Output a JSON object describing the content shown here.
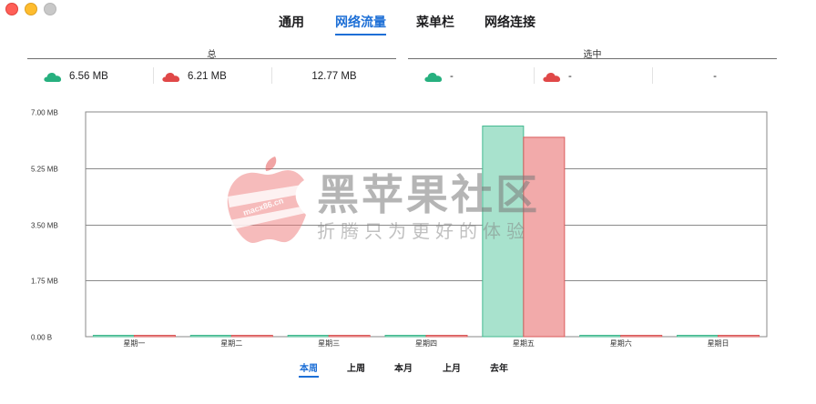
{
  "window": {
    "controls": [
      "close",
      "minimize",
      "maximize"
    ]
  },
  "tabs": [
    {
      "label": "通用",
      "active": false
    },
    {
      "label": "网络流量",
      "active": true
    },
    {
      "label": "菜单栏",
      "active": false
    },
    {
      "label": "网络连接",
      "active": false
    }
  ],
  "summary": {
    "total": {
      "title": "总",
      "upload": "6.56 MB",
      "download": "6.21 MB",
      "sum": "12.77 MB"
    },
    "selected": {
      "title": "选中",
      "upload": "-",
      "download": "-",
      "sum": "-"
    }
  },
  "colors": {
    "upload": "#27b07f",
    "download": "#e04848",
    "upload_bar": "#a8e2cd",
    "download_bar": "#f2aaaa",
    "accent": "#1d6fd6"
  },
  "icons": {
    "upload": "cloud-upload-icon",
    "download": "cloud-download-icon"
  },
  "chart_data": {
    "type": "bar",
    "categories": [
      "星期一",
      "星期二",
      "星期三",
      "星期四",
      "星期五",
      "星期六",
      "星期日"
    ],
    "series": [
      {
        "values": [
          0,
          0,
          0,
          0,
          6.56,
          0,
          0
        ],
        "color": "#a8e2cd",
        "stroke": "#43b990"
      },
      {
        "values": [
          0,
          0,
          0,
          0,
          6.21,
          0,
          0
        ],
        "color": "#f2aaaa",
        "stroke": "#d95b5b"
      }
    ],
    "unit": "MB",
    "ylim": [
      0,
      7
    ],
    "yticks": [
      0,
      1.75,
      3.5,
      5.25,
      7
    ],
    "ytick_labels": [
      "0.00 B",
      "1.75 MB",
      "3.50 MB",
      "5.25 MB",
      "7.00 MB"
    ],
    "grid": true
  },
  "watermark": {
    "title": "黑苹果社区",
    "subtitle": "折腾只为更好的体验",
    "logo_text": "macx86.cn"
  },
  "period_tabs": [
    {
      "label": "本周",
      "active": true
    },
    {
      "label": "上周",
      "active": false
    },
    {
      "label": "本月",
      "active": false
    },
    {
      "label": "上月",
      "active": false
    },
    {
      "label": "去年",
      "active": false
    }
  ]
}
